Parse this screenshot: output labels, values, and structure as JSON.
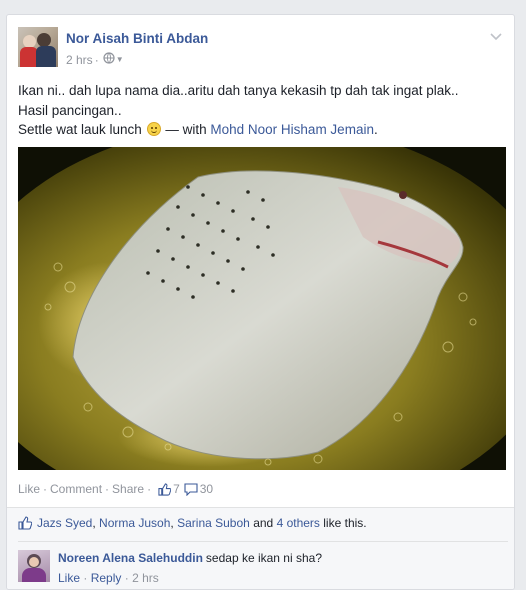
{
  "post": {
    "author": "Nor Aisah Binti Abdan",
    "time": "2 hrs",
    "text_line1": "Ikan ni.. dah lupa nama dia..aritu dah tanya kekasih tp dah tak ingat plak..",
    "text_line2": "Hasil pancingan..",
    "text_line3_prefix": "Settle wat lauk lunch",
    "with_text": "— with",
    "tagged": "Mohd Noor Hisham Jemain",
    "tagged_suffix": "."
  },
  "actions": {
    "like": "Like",
    "comment": "Comment",
    "share": "Share",
    "like_count": "7",
    "comment_count": "30",
    "separator": "·"
  },
  "likes": {
    "names": [
      "Jazs Syed",
      "Norma Jusoh",
      "Sarina Suboh"
    ],
    "comma": ",",
    "and_word": "and",
    "others": "4 others",
    "suffix": "like this."
  },
  "comment": {
    "author": "Noreen Alena Salehuddin",
    "text": "sedap ke ikan ni sha?",
    "like": "Like",
    "reply": "Reply",
    "time": "2 hrs"
  },
  "icons": {
    "privacy": "globe-icon",
    "menu": "chevron-down-icon",
    "like_count": "thumbs-up-icon",
    "comment_count": "speech-bubble-icon"
  },
  "colors": {
    "link": "#3b5998",
    "meta": "#90949c",
    "text": "#1d2129"
  }
}
